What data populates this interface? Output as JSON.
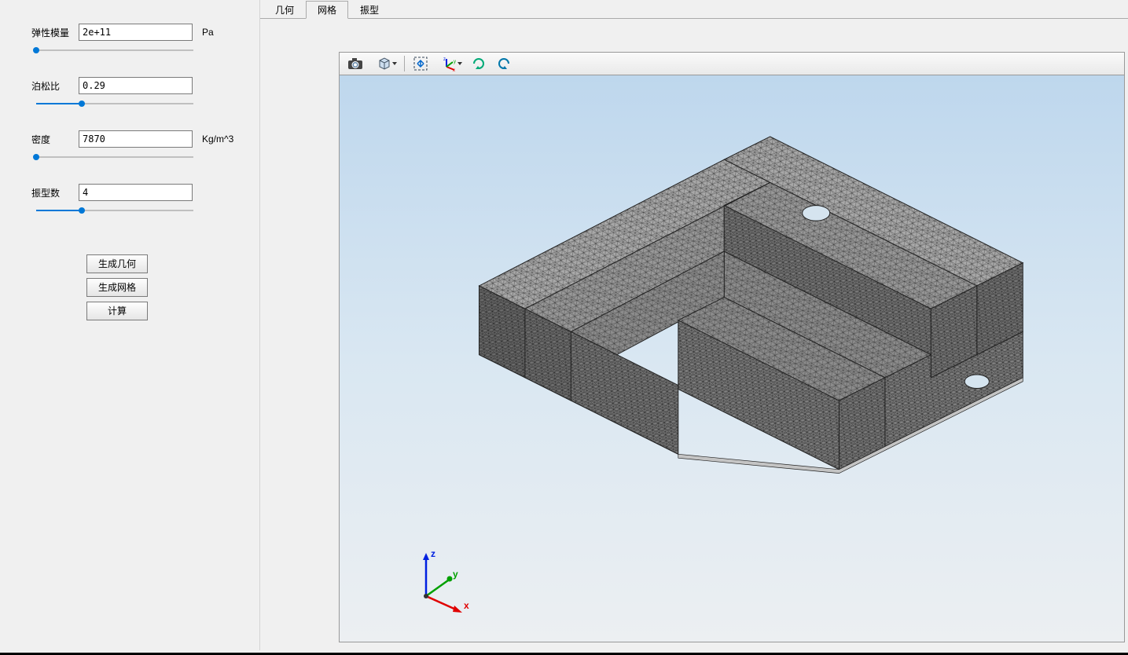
{
  "sidebar": {
    "props": [
      {
        "label": "弹性模量",
        "value": "2e+11",
        "unit": "Pa",
        "sliderPercent": 0
      },
      {
        "label": "泊松比",
        "value": "0.29",
        "unit": "",
        "sliderPercent": 29
      },
      {
        "label": "密度",
        "value": "7870",
        "unit": "Kg/m^3",
        "sliderPercent": 0
      },
      {
        "label": "振型数",
        "value": "4",
        "unit": "",
        "sliderPercent": 29
      }
    ],
    "buttons": {
      "generate_geometry": "生成几何",
      "generate_mesh": "生成网格",
      "calculate": "计算"
    }
  },
  "tabs": {
    "items": [
      "几何",
      "网格",
      "振型"
    ],
    "activeIndex": 1
  },
  "toolbar": {
    "icons": [
      {
        "name": "screenshot-icon",
        "type": "camera"
      },
      {
        "name": "view-cube-icon",
        "type": "cube",
        "withArrow": true
      },
      {
        "sep": true
      },
      {
        "name": "fit-view-icon",
        "type": "fit"
      },
      {
        "name": "axis-triad-icon",
        "type": "triad",
        "withArrow": true
      },
      {
        "name": "rotate-cw-icon",
        "type": "rotcw"
      },
      {
        "name": "rotate-ccw-icon",
        "type": "rotccw"
      }
    ]
  },
  "viewport": {
    "axes": {
      "x": "x",
      "y": "y",
      "z": "z"
    },
    "activeView": "mesh"
  }
}
